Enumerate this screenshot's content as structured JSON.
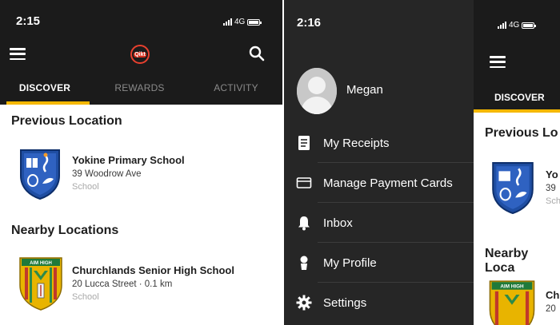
{
  "left_phone": {
    "status": {
      "time": "2:15",
      "network": "4G"
    },
    "header": {
      "logo_text": "Qikt"
    },
    "tabs": [
      {
        "label": "DISCOVER",
        "active": true
      },
      {
        "label": "REWARDS",
        "active": false
      },
      {
        "label": "ACTIVITY",
        "active": false
      }
    ],
    "previous_location": {
      "title": "Previous Location",
      "item": {
        "name": "Yokine Primary School",
        "address": "39 Woodrow Ave",
        "type": "School"
      }
    },
    "nearby_locations": {
      "title": "Nearby Locations",
      "item": {
        "name": "Churchlands Senior High School",
        "address": "20 Lucca Street · 0.1 km",
        "type": "School",
        "crest_text": "AIM HIGH"
      }
    }
  },
  "right_phone": {
    "status": {
      "time": "2:16",
      "network": "4G"
    },
    "drawer": {
      "profile_name": "Megan",
      "menu": [
        {
          "label": "My Receipts",
          "icon": "receipt-icon"
        },
        {
          "label": "Manage Payment Cards",
          "icon": "card-icon"
        },
        {
          "label": "Inbox",
          "icon": "bell-icon"
        },
        {
          "label": "My Profile",
          "icon": "person-icon"
        },
        {
          "label": "Settings",
          "icon": "gear-icon"
        }
      ]
    },
    "behind": {
      "tab_label": "DISCOVER",
      "previous_title": "Previous Lo",
      "previous_name": "Yo",
      "previous_addr": "39",
      "previous_type": "Schl",
      "nearby_title": "Nearby Loca",
      "nearby_name": "Ch",
      "nearby_addr": "20",
      "nearby_crest_text": "AIM HIGH"
    }
  },
  "colors": {
    "header_bg": "#1b1b1b",
    "drawer_bg": "#262626",
    "accent_yellow": "#f5b800",
    "logo_red": "#e8402e"
  }
}
